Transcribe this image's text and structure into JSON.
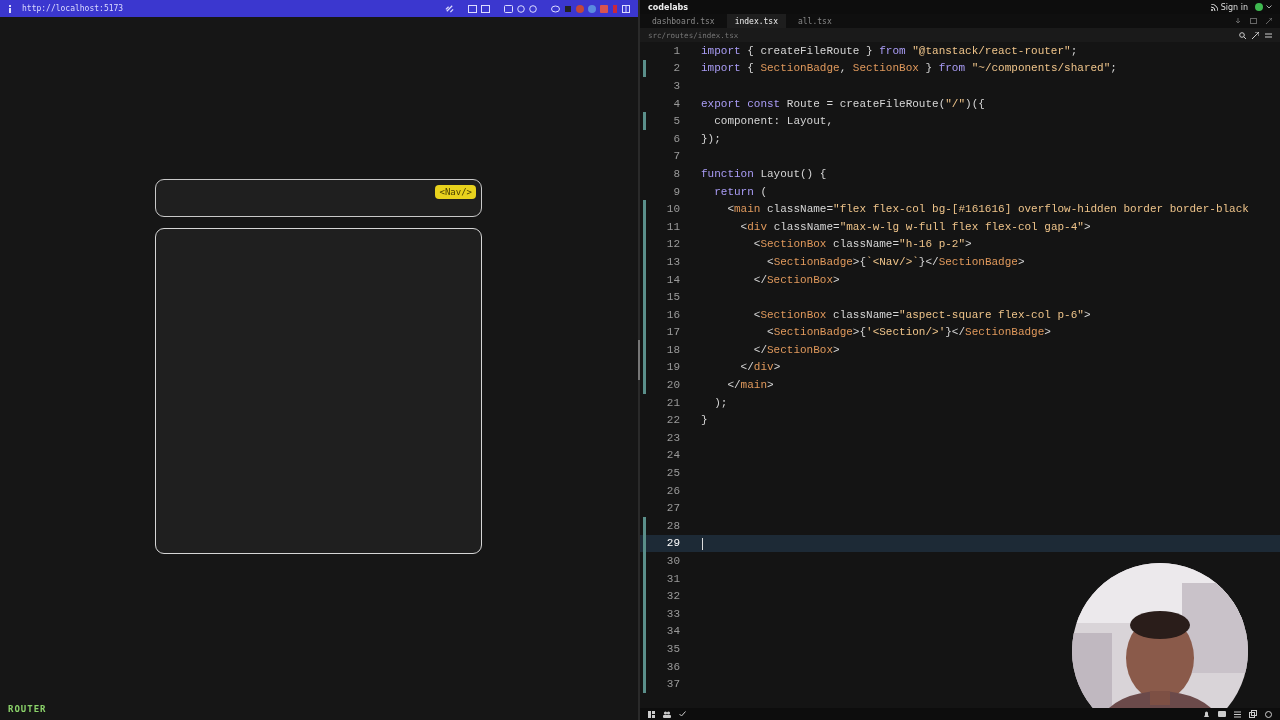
{
  "browser": {
    "url": "http://localhost:5173"
  },
  "preview": {
    "nav_badge": "<Nav/>",
    "footer_label": "ROUTER"
  },
  "editor": {
    "app_title": "codelabs",
    "sign_in": "Sign in",
    "tabs": [
      {
        "label": "dashboard.tsx",
        "selected": false
      },
      {
        "label": "index.tsx",
        "selected": true
      },
      {
        "label": "all.tsx",
        "selected": false
      }
    ],
    "path": "src/routes/index.tsx",
    "lines": [
      {
        "number": "1",
        "modified": false,
        "current": false,
        "tokens": [
          {
            "kind": "kw",
            "text": "import"
          },
          {
            "kind": "plain",
            "text": " { createFileRoute } "
          },
          {
            "kind": "kw",
            "text": "from"
          },
          {
            "kind": "str",
            "text": " \"@tanstack/react-router\""
          },
          {
            "kind": "plain",
            "text": ";"
          }
        ]
      },
      {
        "number": "2",
        "modified": true,
        "current": false,
        "tokens": [
          {
            "kind": "kw",
            "text": "import"
          },
          {
            "kind": "plain",
            "text": " { "
          },
          {
            "kind": "tag",
            "text": "SectionBadge"
          },
          {
            "kind": "plain",
            "text": ", "
          },
          {
            "kind": "tag",
            "text": "SectionBox"
          },
          {
            "kind": "plain",
            "text": " } "
          },
          {
            "kind": "kw",
            "text": "from"
          },
          {
            "kind": "str",
            "text": " \"~/components/shared\""
          },
          {
            "kind": "plain",
            "text": ";"
          }
        ]
      },
      {
        "number": "3",
        "modified": false,
        "current": false
      },
      {
        "number": "4",
        "modified": false,
        "current": false,
        "tokens": [
          {
            "kind": "kw",
            "text": "export const"
          },
          {
            "kind": "plain",
            "text": " Route = createFileRoute("
          },
          {
            "kind": "str",
            "text": "\"/\""
          },
          {
            "kind": "plain",
            "text": ")({"
          }
        ]
      },
      {
        "number": "5",
        "modified": true,
        "current": false,
        "tokens": [
          {
            "kind": "plain",
            "text": "  component: Layout,"
          }
        ]
      },
      {
        "number": "6",
        "modified": false,
        "current": false,
        "tokens": [
          {
            "kind": "plain",
            "text": "});"
          }
        ]
      },
      {
        "number": "7",
        "modified": false,
        "current": false
      },
      {
        "number": "8",
        "modified": false,
        "current": false,
        "tokens": [
          {
            "kind": "kw",
            "text": "function"
          },
          {
            "kind": "plain",
            "text": " Layout() {"
          }
        ]
      },
      {
        "number": "9",
        "modified": false,
        "current": false,
        "tokens": [
          {
            "kind": "kw",
            "text": "  return"
          },
          {
            "kind": "plain",
            "text": " ("
          }
        ]
      },
      {
        "number": "10",
        "modified": true,
        "current": false,
        "tokens": [
          {
            "kind": "plain",
            "text": "    <"
          },
          {
            "kind": "tag",
            "text": "main"
          },
          {
            "kind": "plain",
            "text": " className="
          },
          {
            "kind": "str",
            "text": "\"flex flex-col bg-[#161616] overflow-hidden border border-black"
          }
        ]
      },
      {
        "number": "11",
        "modified": true,
        "current": false,
        "tokens": [
          {
            "kind": "plain",
            "text": "      <"
          },
          {
            "kind": "tag",
            "text": "div"
          },
          {
            "kind": "plain",
            "text": " className="
          },
          {
            "kind": "str",
            "text": "\"max-w-lg w-full flex flex-col gap-4\""
          },
          {
            "kind": "plain",
            "text": ">"
          }
        ]
      },
      {
        "number": "12",
        "modified": true,
        "current": false,
        "tokens": [
          {
            "kind": "plain",
            "text": "        <"
          },
          {
            "kind": "tag",
            "text": "SectionBox"
          },
          {
            "kind": "plain",
            "text": " className="
          },
          {
            "kind": "str",
            "text": "\"h-16 p-2\""
          },
          {
            "kind": "plain",
            "text": ">"
          }
        ]
      },
      {
        "number": "13",
        "modified": true,
        "current": false,
        "tokens": [
          {
            "kind": "plain",
            "text": "          <"
          },
          {
            "kind": "tag",
            "text": "SectionBadge"
          },
          {
            "kind": "plain",
            "text": ">{"
          },
          {
            "kind": "str",
            "text": "`<Nav/>`"
          },
          {
            "kind": "plain",
            "text": "}</"
          },
          {
            "kind": "tag",
            "text": "SectionBadge"
          },
          {
            "kind": "plain",
            "text": ">"
          }
        ]
      },
      {
        "number": "14",
        "modified": true,
        "current": false,
        "tokens": [
          {
            "kind": "plain",
            "text": "        </"
          },
          {
            "kind": "tag",
            "text": "SectionBox"
          },
          {
            "kind": "plain",
            "text": ">"
          }
        ]
      },
      {
        "number": "15",
        "modified": true,
        "current": false
      },
      {
        "number": "16",
        "modified": true,
        "current": false,
        "tokens": [
          {
            "kind": "plain",
            "text": "        <"
          },
          {
            "kind": "tag",
            "text": "SectionBox"
          },
          {
            "kind": "plain",
            "text": " className="
          },
          {
            "kind": "str",
            "text": "\"aspect-square flex-col p-6\""
          },
          {
            "kind": "plain",
            "text": ">"
          }
        ]
      },
      {
        "number": "17",
        "modified": true,
        "current": false,
        "tokens": [
          {
            "kind": "plain",
            "text": "          <"
          },
          {
            "kind": "tag",
            "text": "SectionBadge"
          },
          {
            "kind": "plain",
            "text": ">{"
          },
          {
            "kind": "str",
            "text": "'<Section/>'"
          },
          {
            "kind": "plain",
            "text": "}</"
          },
          {
            "kind": "tag",
            "text": "SectionBadge"
          },
          {
            "kind": "plain",
            "text": ">"
          }
        ]
      },
      {
        "number": "18",
        "modified": true,
        "current": false,
        "tokens": [
          {
            "kind": "plain",
            "text": "        </"
          },
          {
            "kind": "tag",
            "text": "SectionBox"
          },
          {
            "kind": "plain",
            "text": ">"
          }
        ]
      },
      {
        "number": "19",
        "modified": true,
        "current": false,
        "tokens": [
          {
            "kind": "plain",
            "text": "      </"
          },
          {
            "kind": "tag",
            "text": "div"
          },
          {
            "kind": "plain",
            "text": ">"
          }
        ]
      },
      {
        "number": "20",
        "modified": true,
        "current": false,
        "tokens": [
          {
            "kind": "plain",
            "text": "    </"
          },
          {
            "kind": "tag",
            "text": "main"
          },
          {
            "kind": "plain",
            "text": ">"
          }
        ]
      },
      {
        "number": "21",
        "modified": false,
        "current": false,
        "tokens": [
          {
            "kind": "plain",
            "text": "  );"
          }
        ]
      },
      {
        "number": "22",
        "modified": false,
        "current": false,
        "tokens": [
          {
            "kind": "plain",
            "text": "}"
          }
        ]
      },
      {
        "number": "23",
        "modified": false,
        "current": false
      },
      {
        "number": "24",
        "modified": false,
        "current": false
      },
      {
        "number": "25",
        "modified": false,
        "current": false
      },
      {
        "number": "26",
        "modified": false,
        "current": false
      },
      {
        "number": "27",
        "modified": false,
        "current": false
      },
      {
        "number": "28",
        "modified": true,
        "current": false
      },
      {
        "number": "29",
        "modified": true,
        "current": true
      },
      {
        "number": "30",
        "modified": true,
        "current": false
      },
      {
        "number": "31",
        "modified": true,
        "current": false
      },
      {
        "number": "32",
        "modified": true,
        "current": false
      },
      {
        "number": "33",
        "modified": true,
        "current": false
      },
      {
        "number": "34",
        "modified": true,
        "current": false
      },
      {
        "number": "35",
        "modified": true,
        "current": false
      },
      {
        "number": "36",
        "modified": true,
        "current": false
      },
      {
        "number": "37",
        "modified": true,
        "current": false
      }
    ]
  }
}
